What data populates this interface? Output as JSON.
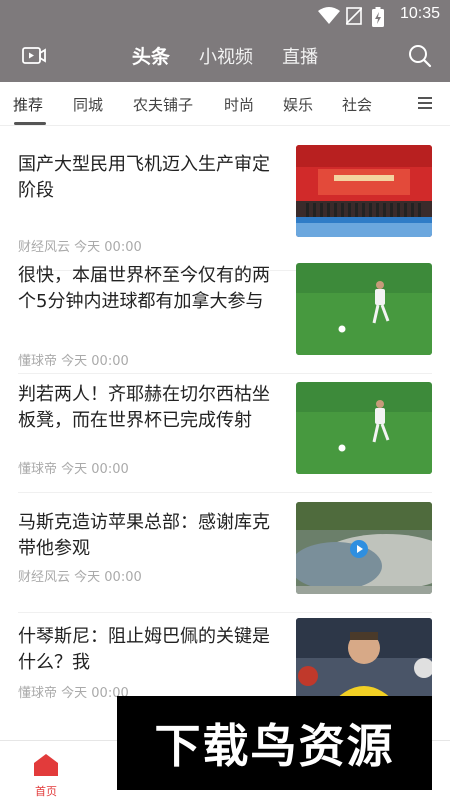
{
  "status_bar": {
    "time": "10:35"
  },
  "header": {
    "tabs": [
      {
        "label": "头条",
        "active": true
      },
      {
        "label": "小视频",
        "active": false
      },
      {
        "label": "直播",
        "active": false
      }
    ]
  },
  "categories": {
    "items": [
      "推荐",
      "同城",
      "农夫铺子",
      "时尚",
      "娱乐",
      "社会"
    ],
    "active_index": 0
  },
  "feed": [
    {
      "title": "国产大型民用飞机迈入生产审定阶段",
      "source": "财经风云",
      "time": "今天 00:00",
      "thumb": "stage-ceremony"
    },
    {
      "title": "很快，本届世界杯至今仅有的两个5分钟内进球都有加拿大参与",
      "source": "懂球帝",
      "time": "今天 00:00",
      "thumb": "soccer-player"
    },
    {
      "title": "判若两人！齐耶赫在切尔西枯坐板凳，而在世界杯已完成传射",
      "source": "懂球帝",
      "time": "今天 00:00",
      "thumb": "soccer-player"
    },
    {
      "title": "马斯克造访苹果总部：感谢库克带他参观",
      "source": "财经风云",
      "time": "今天 00:00",
      "thumb": "apple-park-video"
    },
    {
      "title": "什琴斯尼：阻止姆巴佩的关键是什么？我",
      "source": "懂球帝",
      "time": "今天 00:00",
      "thumb": "goalkeeper"
    }
  ],
  "bottom_nav": {
    "home_label": "首页"
  },
  "watermark": {
    "text": "下载鸟资源"
  },
  "colors": {
    "header_bg": "#7e7a7c",
    "accent": "#e23b3b"
  }
}
